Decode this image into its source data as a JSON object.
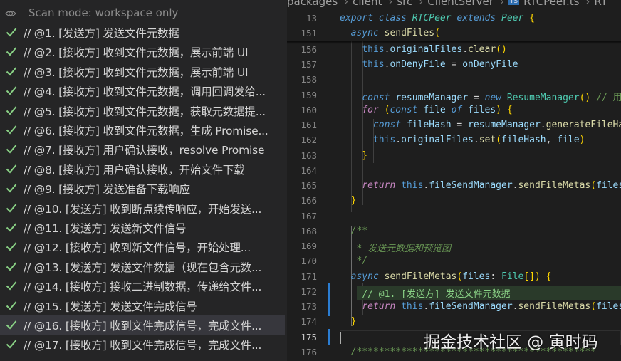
{
  "panel": {
    "scan_mode": "Scan mode: workspace only",
    "items": [
      {
        "label": "// @1. [发送方] 发送文件元数据"
      },
      {
        "label": "// @2. [接收方] 收到文件元数据，展示前端 UI"
      },
      {
        "label": "// @3. [接收方] 收到文件元数据，展示前端 UI"
      },
      {
        "label": "// @4. [接收方] 收到文件元数据，调用回调发给..."
      },
      {
        "label": "// @5. [接收方] 收到文件元数据，获取元数据提..."
      },
      {
        "label": "// @6. [接收方] 收到文件元数据，生成 Promise..."
      },
      {
        "label": "// @7. [接收方] 用户确认接收，resolve Promise"
      },
      {
        "label": "// @8. [接收方] 用户确认接收，开始文件下载"
      },
      {
        "label": "// @9. [接收方] 发送准备下载响应"
      },
      {
        "label": "// @10. [发送方] 收到断点续传响应，开始发送..."
      },
      {
        "label": "// @11. [发送方] 发送新文件信号"
      },
      {
        "label": "// @12. [接收方] 收到新文件信号，开始处理..."
      },
      {
        "label": "// @13. [发送方] 发送文件数据（现在包含元数..."
      },
      {
        "label": "// @14. [接收方] 接收二进制数据，传递给文件..."
      },
      {
        "label": "// @15. [发送方] 发送文件完成信号"
      },
      {
        "label": "// @16. [接收方] 收到文件完成信号，完成文件...",
        "selected": true
      },
      {
        "label": "// @17. [接收方] 收到文件完成信号，完成文件..."
      }
    ],
    "check_color": "#89d185"
  },
  "editor": {
    "breadcrumb": {
      "parts": [
        "packages",
        "client",
        "src",
        "ClientServer"
      ],
      "file_badge": "TS",
      "file": "RTCPeer.ts",
      "tail": "RT"
    },
    "lines": [
      {
        "num": "13"
      },
      {
        "num": "151"
      },
      {
        "num": "156"
      },
      {
        "num": "157"
      },
      {
        "num": "158"
      },
      {
        "num": "159"
      },
      {
        "num": "160"
      },
      {
        "num": "161"
      },
      {
        "num": "162"
      },
      {
        "num": "163"
      },
      {
        "num": "164"
      },
      {
        "num": "165"
      },
      {
        "num": "166"
      },
      {
        "num": "167"
      },
      {
        "num": "168"
      },
      {
        "num": "169"
      },
      {
        "num": "170"
      },
      {
        "num": "171"
      },
      {
        "num": "172"
      },
      {
        "num": "173"
      },
      {
        "num": "174"
      },
      {
        "num": "175"
      },
      {
        "num": "176"
      }
    ],
    "code": {
      "l13": {
        "a": "export",
        "b": "class",
        "c": "RTCPeer",
        "d": "extends",
        "e": "Peer",
        "f": " {"
      },
      "l151": {
        "a": "async",
        "b": "sendFiles",
        "c": "("
      },
      "l156": {
        "a": "this",
        "b": ".",
        "c": "originalFiles",
        "d": ".",
        "e": "clear",
        "f": "()"
      },
      "l157": {
        "a": "this",
        "b": ".",
        "c": "onDenyFile",
        "d": " = ",
        "e": "onDenyFile"
      },
      "l159": {
        "a": "const",
        "b": "resumeManager",
        "c": " = ",
        "d": "new",
        "e": "ResumeManager",
        "f": "() ",
        "g": "// 用于"
      },
      "l160": {
        "a": "for",
        "b": " (",
        "c": "const",
        "d": "file",
        "e": "of",
        "f": "files",
        "g": ") {"
      },
      "l161": {
        "a": "const",
        "b": "fileHash",
        "c": " = ",
        "d": "resumeManager",
        "e": ".",
        "f": "generateFileHash"
      },
      "l162": {
        "a": "this",
        "b": ".",
        "c": "originalFiles",
        "d": ".",
        "e": "set",
        "f": "(",
        "g": "fileHash",
        "h": ", ",
        "i": "file",
        "j": ")"
      },
      "l163": {
        "a": "}"
      },
      "l165": {
        "a": "return",
        "b": "this",
        "c": ".",
        "d": "fileSendManager",
        "e": ".",
        "f": "sendFileMetas",
        "g": "(",
        "h": "files",
        "i": ")"
      },
      "l166": {
        "a": "}"
      },
      "l168": {
        "a": "/**"
      },
      "l169": {
        "a": " * 发送元数据和预览图"
      },
      "l170": {
        "a": " */"
      },
      "l171": {
        "a": "async",
        "b": "sendFileMetas",
        "c": "(",
        "d": "files",
        "e": ": ",
        "f": "File",
        "g": "[]) {"
      },
      "l172": {
        "a": "// @1. [发送方] 发送文件元数据"
      },
      "l173": {
        "a": "return",
        "b": "this",
        "c": ".",
        "d": "fileSendManager",
        "e": ".",
        "f": "sendFileMetas",
        "g": "(",
        "h": "files",
        "i": ")"
      },
      "l174": {
        "a": "}"
      },
      "l176": {
        "a": "/*******************************************"
      }
    }
  },
  "watermark": "掘金技术社区 @ 寅时码"
}
